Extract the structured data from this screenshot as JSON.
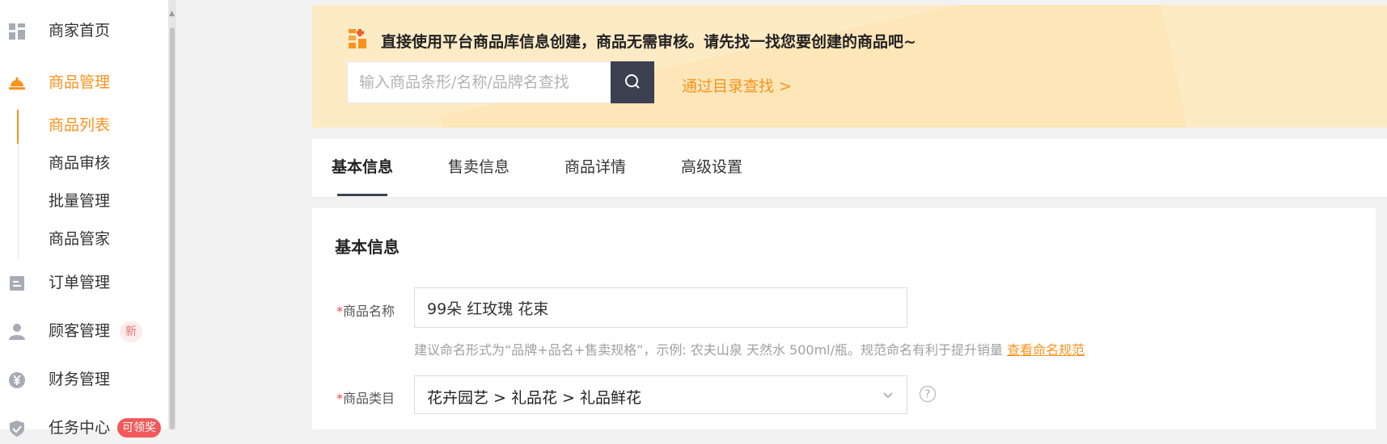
{
  "sidebar": {
    "items": [
      {
        "label": "商家首页",
        "icon": "dashboard-grid-icon"
      },
      {
        "label": "商品管理",
        "icon": "product-tray-icon",
        "active": true
      },
      {
        "label": "订单管理",
        "icon": "order-document-icon"
      },
      {
        "label": "顾客管理",
        "icon": "customer-person-icon",
        "badge": "新"
      },
      {
        "label": "财务管理",
        "icon": "yen-coin-icon"
      },
      {
        "label": "任务中心",
        "icon": "task-shield-icon",
        "badge": "可领奖"
      }
    ],
    "subitems": [
      {
        "label": "商品列表",
        "active": true
      },
      {
        "label": "商品审核"
      },
      {
        "label": "批量管理"
      },
      {
        "label": "商品管家"
      }
    ]
  },
  "banner": {
    "text": "直接使用平台商品库信息创建，商品无需审核。请先找一找您要创建的商品吧~",
    "search_placeholder": "输入商品条形/名称/品牌名查找",
    "catalog_link": "通过目录查找 >"
  },
  "tabs": [
    {
      "label": "基本信息",
      "active": true
    },
    {
      "label": "售卖信息"
    },
    {
      "label": "商品详情"
    },
    {
      "label": "高级设置"
    }
  ],
  "form": {
    "section_title": "基本信息",
    "required_mark": "*",
    "name_label": "商品名称",
    "name_value": "99朵 红玫瑰 花束",
    "name_hint": "建议命名形式为“品牌+品名+售卖规格”，示例: 农夫山泉 天然水 500ml/瓶。规范命名有利于提升销量",
    "name_hint_link": "查看命名规范",
    "category_label": "商品类目",
    "category_value": "花卉园艺 > 礼品花 > 礼品鲜花"
  },
  "colors": {
    "accent": "#f7931e",
    "banner_bg": "#fdebc6",
    "search_button": "#3b4151",
    "required": "#f04848"
  }
}
